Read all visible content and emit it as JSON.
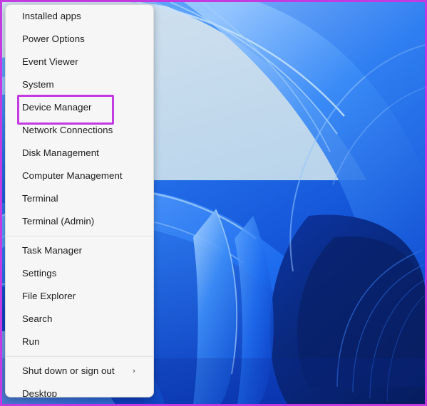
{
  "desktop": {
    "wallpaper_name": "windows-11-bloom-wallpaper",
    "wallpaper_colors": {
      "sky": "#c3d9ec",
      "light_blue": "#4f9bfa",
      "mid_blue": "#1f6ef0",
      "deep_blue": "#0b3bc4",
      "dark_blue": "#082a96",
      "darkest_blue": "#071f6e"
    }
  },
  "annotation": {
    "border_color": "#c23ae0",
    "highlight_color": "#c23ae0",
    "highlight_target": "Device Manager"
  },
  "context_menu": {
    "name": "win-x-power-user-menu",
    "background": "#f6f6f6",
    "text_color": "#1b1b1b",
    "separator_color": "#e3e3e3",
    "groups": [
      {
        "items": [
          {
            "label": "Installed apps",
            "submenu": false
          },
          {
            "label": "Power Options",
            "submenu": false
          },
          {
            "label": "Event Viewer",
            "submenu": false
          },
          {
            "label": "System",
            "submenu": false
          },
          {
            "label": "Device Manager",
            "submenu": false
          },
          {
            "label": "Network Connections",
            "submenu": false
          },
          {
            "label": "Disk Management",
            "submenu": false
          },
          {
            "label": "Computer Management",
            "submenu": false
          },
          {
            "label": "Terminal",
            "submenu": false
          },
          {
            "label": "Terminal (Admin)",
            "submenu": false
          }
        ]
      },
      {
        "items": [
          {
            "label": "Task Manager",
            "submenu": false
          },
          {
            "label": "Settings",
            "submenu": false
          },
          {
            "label": "File Explorer",
            "submenu": false
          },
          {
            "label": "Search",
            "submenu": false
          },
          {
            "label": "Run",
            "submenu": false
          }
        ]
      },
      {
        "items": [
          {
            "label": "Shut down or sign out",
            "submenu": true,
            "submenu_glyph": "›"
          },
          {
            "label": "Desktop",
            "submenu": false
          }
        ]
      }
    ]
  }
}
